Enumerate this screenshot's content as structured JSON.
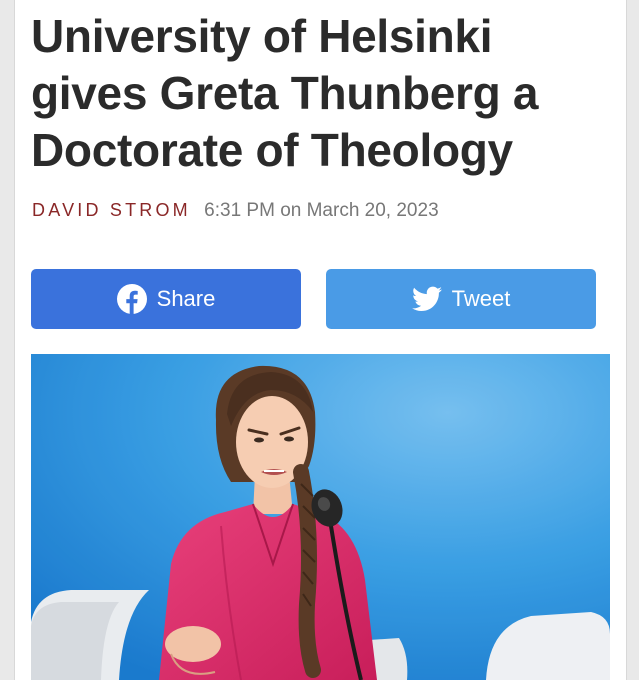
{
  "article": {
    "headline": "University of Helsinki gives Greta Thunberg a Doctorate of Theology",
    "author": "DAVID STROM",
    "timestamp": "6:31 PM on March 20, 2023"
  },
  "share": {
    "facebook_label": "Share",
    "twitter_label": "Tweet",
    "facebook_icon": "facebook-icon",
    "twitter_icon": "twitter-icon"
  },
  "colors": {
    "author": "#8a2727",
    "share_button": "#3a72dc",
    "tweet_button": "#4a9be6"
  }
}
